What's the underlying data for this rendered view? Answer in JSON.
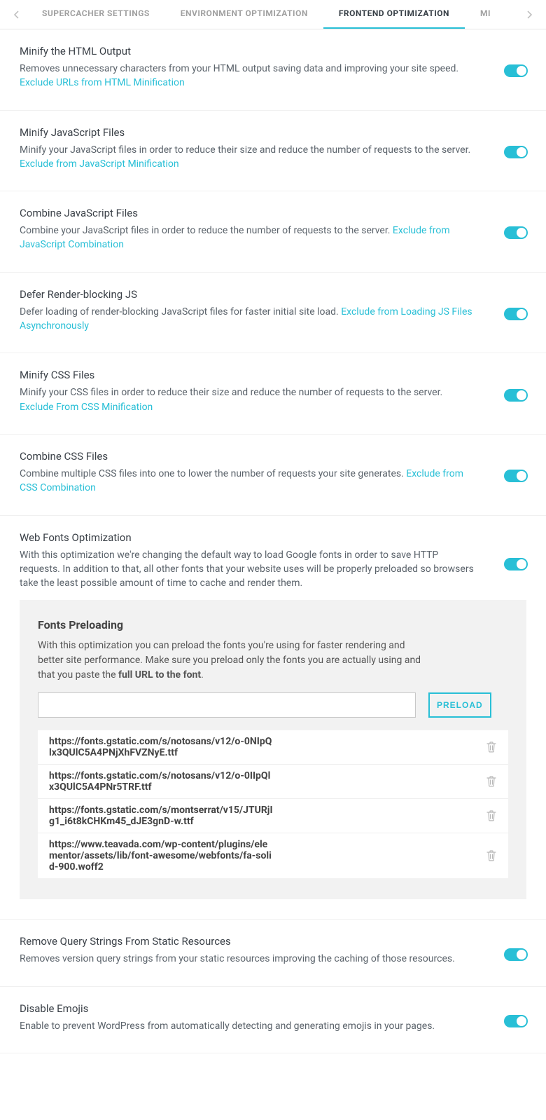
{
  "tabs": {
    "items": [
      {
        "label": "SUPERCACHER SETTINGS"
      },
      {
        "label": "ENVIRONMENT OPTIMIZATION"
      },
      {
        "label": "FRONTEND OPTIMIZATION"
      },
      {
        "label": "MI"
      }
    ]
  },
  "settings": [
    {
      "title": "Minify the HTML Output",
      "desc": "Removes unnecessary characters from your HTML output saving data and improving your site speed. ",
      "link": "Exclude URLs from HTML Minification",
      "on": true
    },
    {
      "title": "Minify JavaScript Files",
      "desc": "Minify your JavaScript files in order to reduce their size and reduce the number of requests to the server. ",
      "link": "Exclude from JavaScript Minification",
      "on": true
    },
    {
      "title": "Combine JavaScript Files",
      "desc": "Combine your JavaScript files in order to reduce the number of requests to the server. ",
      "link": "Exclude from JavaScript Combination",
      "on": true
    },
    {
      "title": "Defer Render-blocking JS",
      "desc": "Defer loading of render-blocking JavaScript files for faster initial site load. ",
      "link": "Exclude from Loading JS Files Asynchronously",
      "on": true
    },
    {
      "title": "Minify CSS Files",
      "desc": "Minify your CSS files in order to reduce their size and reduce the number of requests to the server. ",
      "link": "Exclude From CSS Minification",
      "on": true
    },
    {
      "title": "Combine CSS Files",
      "desc": "Combine multiple CSS files into one to lower the number of requests your site generates. ",
      "link": "Exclude from CSS Combination",
      "on": true
    },
    {
      "title": "Web Fonts Optimization",
      "desc": "With this optimization we're changing the default way to load Google fonts in order to save HTTP requests. In addition to that, all other fonts that your website uses will be properly preloaded so browsers take the least possible amount of time to cache and render them.",
      "link": "",
      "on": true
    }
  ],
  "panel": {
    "title": "Fonts Preloading",
    "desc_pre": "With this optimization you can preload the fonts you're using for faster rendering and better site performance. Make sure you preload only the fonts you are actually using and that you paste the ",
    "desc_bold": "full URL to the font",
    "desc_post": ".",
    "button": "PRELOAD",
    "fonts": [
      "https://fonts.gstatic.com/s/notosans/v12/o-0NIpQlx3QUlC5A4PNjXhFVZNyE.ttf",
      "https://fonts.gstatic.com/s/notosans/v12/o-0IIpQlx3QUlC5A4PNr5TRF.ttf",
      "https://fonts.gstatic.com/s/montserrat/v15/JTURjIg1_i6t8kCHKm45_dJE3gnD-w.ttf",
      "https://www.teavada.com/wp-content/plugins/elementor/assets/lib/font-awesome/webfonts/fa-solid-900.woff2"
    ]
  },
  "settings_after": [
    {
      "title": "Remove Query Strings From Static Resources",
      "desc": "Removes version query strings from your static resources improving the caching of those resources.",
      "on": true
    },
    {
      "title": "Disable Emojis",
      "desc": "Enable to prevent WordPress from automatically detecting and generating emojis in your pages.",
      "on": true
    }
  ]
}
